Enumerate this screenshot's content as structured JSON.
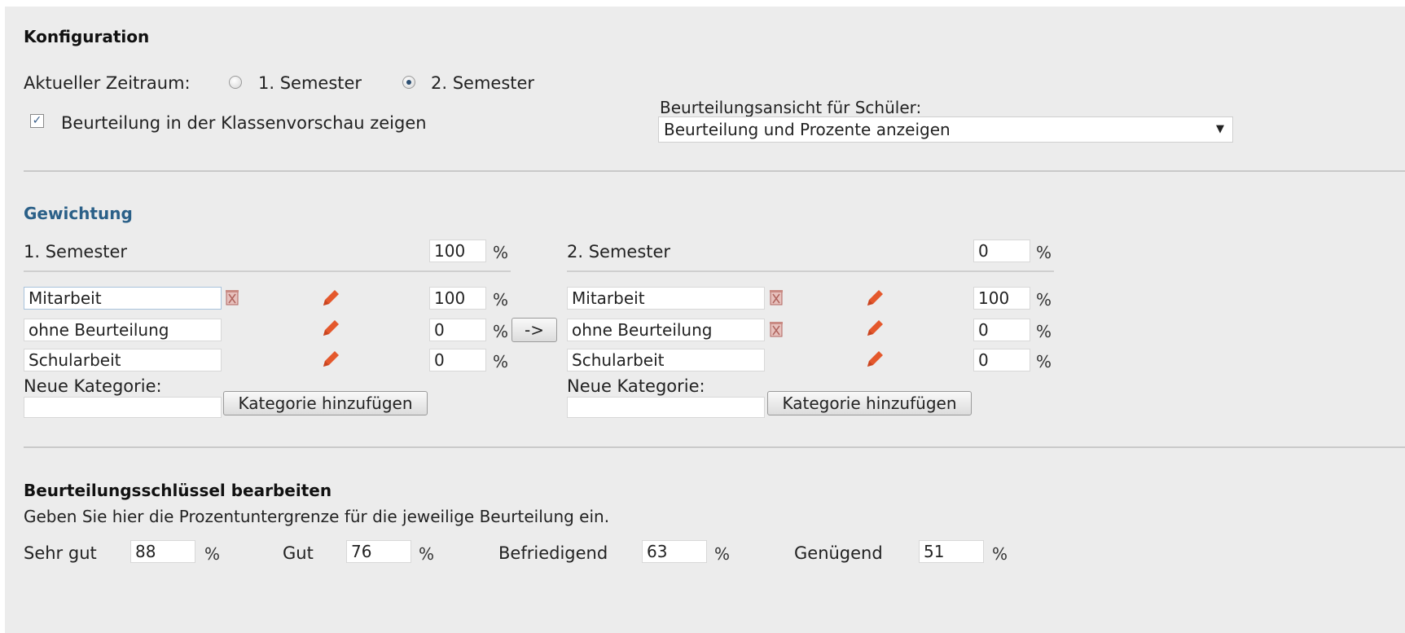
{
  "config": {
    "heading": "Konfiguration",
    "period_label": "Aktueller Zeitraum:",
    "radio_semester1": "1. Semester",
    "radio_semester2": "2. Semester",
    "selected_period": "2. Semester",
    "checkbox_label": "Beurteilung in der Klassenvorschau zeigen",
    "checkbox_checked": true,
    "view_label": "Beurteilungsansicht für Schüler:",
    "view_value": "Beurteilung und Prozente anzeigen"
  },
  "weighting": {
    "heading": "Gewichtung",
    "copy_button": "->",
    "semester1": {
      "title": "1. Semester",
      "total": "100",
      "unit": "%",
      "categories": [
        {
          "name": "Mitarbeit",
          "value": "100",
          "unit": "%"
        },
        {
          "name": "ohne Beurteilung",
          "value": "0",
          "unit": "%"
        },
        {
          "name": "Schularbeit",
          "value": "0",
          "unit": "%"
        }
      ],
      "new_label": "Neue Kategorie:",
      "new_value": "",
      "add_button": "Kategorie hinzufügen"
    },
    "semester2": {
      "title": "2. Semester",
      "total": "0",
      "unit": "%",
      "categories": [
        {
          "name": "Mitarbeit",
          "value": "100",
          "unit": "%"
        },
        {
          "name": "ohne Beurteilung",
          "value": "0",
          "unit": "%"
        },
        {
          "name": "Schularbeit",
          "value": "0",
          "unit": "%"
        }
      ],
      "new_label": "Neue Kategorie:",
      "new_value": "",
      "add_button": "Kategorie hinzufügen"
    }
  },
  "grading": {
    "heading": "Beurteilungsschlüssel bearbeiten",
    "description": "Geben Sie hier die Prozentuntergrenze für die jeweilige Beurteilung ein.",
    "grades": [
      {
        "label": "Sehr gut",
        "value": "88",
        "unit": "%"
      },
      {
        "label": "Gut",
        "value": "76",
        "unit": "%"
      },
      {
        "label": "Befriedigend",
        "value": "63",
        "unit": "%"
      },
      {
        "label": "Genügend",
        "value": "51",
        "unit": "%"
      }
    ]
  },
  "icons": {
    "delete": "delete-icon",
    "edit": "pencil-icon",
    "dropdown": "chevron-down-icon"
  },
  "colors": {
    "panel_bg": "#ececec",
    "section_heading_blue": "#2b6088",
    "pencil_orange": "#e4582c"
  }
}
